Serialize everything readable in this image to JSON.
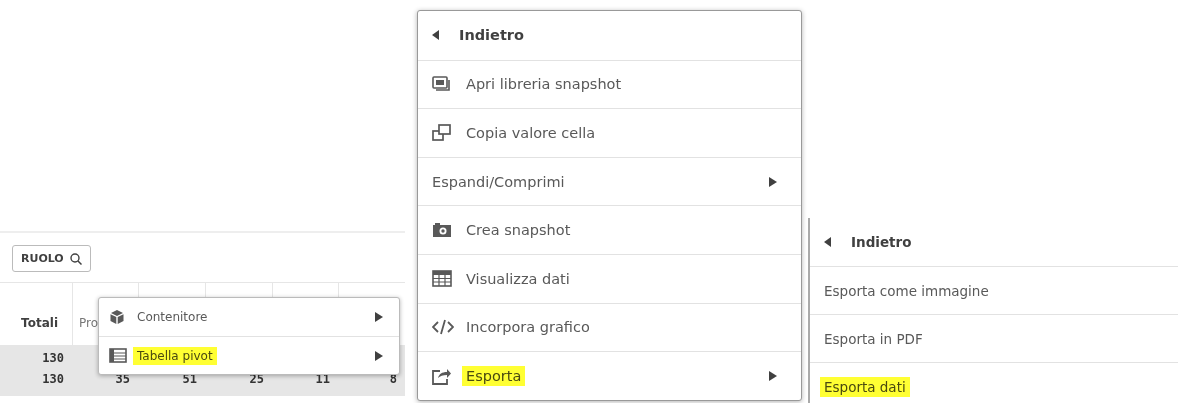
{
  "table_panel": {
    "search_button": {
      "label": "RUOLO"
    },
    "columns": [
      "Totali",
      "Pro",
      "",
      "",
      "",
      ""
    ],
    "rows": [
      [
        "130",
        "",
        "",
        "",
        "",
        ""
      ],
      [
        "130",
        "35",
        "51",
        "25",
        "11",
        "8"
      ]
    ],
    "context_menu": {
      "items": [
        {
          "label": "Contenitore",
          "submenu": true,
          "highlighted": false
        },
        {
          "label": "Tabella pivot",
          "submenu": true,
          "highlighted": true
        }
      ]
    }
  },
  "main_menu": {
    "back": {
      "label": "Indietro"
    },
    "items": [
      {
        "label": "Apri libreria snapshot",
        "submenu": false,
        "highlighted": false
      },
      {
        "label": "Copia valore cella",
        "submenu": false,
        "highlighted": false
      },
      {
        "label": "Espandi/Comprimi",
        "submenu": true,
        "highlighted": false
      },
      {
        "label": "Crea snapshot",
        "submenu": false,
        "highlighted": false
      },
      {
        "label": "Visualizza dati",
        "submenu": false,
        "highlighted": false
      },
      {
        "label": "Incorpora grafico",
        "submenu": false,
        "highlighted": false
      },
      {
        "label": "Esporta",
        "submenu": true,
        "highlighted": true
      }
    ]
  },
  "export_menu": {
    "back": {
      "label": "Indietro"
    },
    "items": [
      {
        "label": "Esporta come immagine",
        "submenu": false,
        "highlighted": false
      },
      {
        "label": "Esporta in PDF",
        "submenu": false,
        "highlighted": false
      },
      {
        "label": "Esporta dati",
        "submenu": false,
        "highlighted": true
      }
    ]
  }
}
